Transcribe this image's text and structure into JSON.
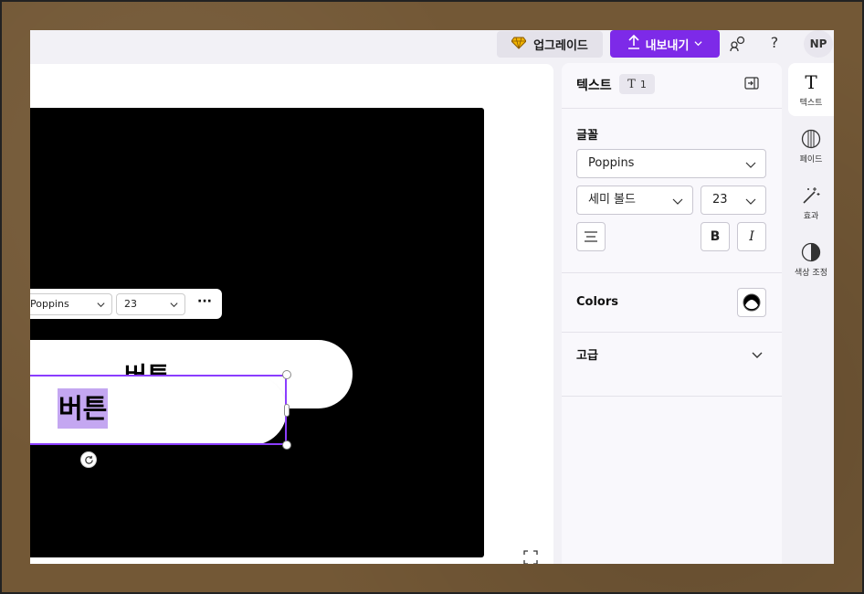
{
  "topbar": {
    "upgrade_label": "업그레이드",
    "export_label": "내보내기",
    "avatar_initials": "NP",
    "help_glyph": "?"
  },
  "canvas": {
    "button_back_text": "버튼",
    "button_front_text": "버튼",
    "artboard_color": "#000000"
  },
  "float_toolbar": {
    "font": "Poppins",
    "size": "23",
    "more_glyph": "···"
  },
  "panel": {
    "title": "텍스트",
    "count": "1",
    "font_section_label": "글꼴",
    "font_value": "Poppins",
    "weight_value": "세미 볼드",
    "size_value": "23",
    "bold_glyph": "B",
    "italic_glyph": "I",
    "colors_label": "Colors",
    "advanced_label": "고급"
  },
  "rail": {
    "items": [
      {
        "label": "텍스트",
        "icon": "text-icon"
      },
      {
        "label": "페이드",
        "icon": "fade-icon"
      },
      {
        "label": "효과",
        "icon": "magic-wand-icon"
      },
      {
        "label": "색상 조정",
        "icon": "contrast-icon"
      }
    ]
  },
  "colors": {
    "accent": "#7d2ae8",
    "selection": "#8b3dff",
    "highlight": "#c4a7f1"
  }
}
